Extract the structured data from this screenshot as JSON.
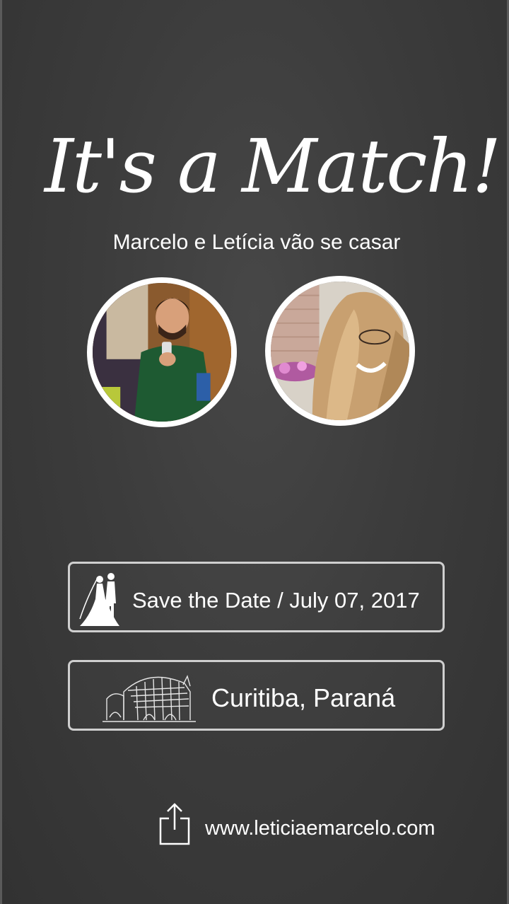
{
  "header": {
    "title": "It's a Match!",
    "subtitle": "Marcelo e Letícia vão se casar"
  },
  "profiles": [
    {
      "name": "Marcelo",
      "photo": "man-selfie-photo"
    },
    {
      "name": "Letícia",
      "photo": "woman-selfie-photo"
    }
  ],
  "date_box": {
    "icon": "bride-groom-icon",
    "label": "Save the Date / July 07, 2017"
  },
  "place_box": {
    "icon": "venue-castle-icon",
    "label": "Curitiba, Paraná"
  },
  "footer": {
    "icon": "share-icon",
    "website": "www.leticiaemarcelo.com"
  },
  "colors": {
    "background": "#3c3c3c",
    "text": "#ffffff",
    "border": "#cfcfcf"
  }
}
